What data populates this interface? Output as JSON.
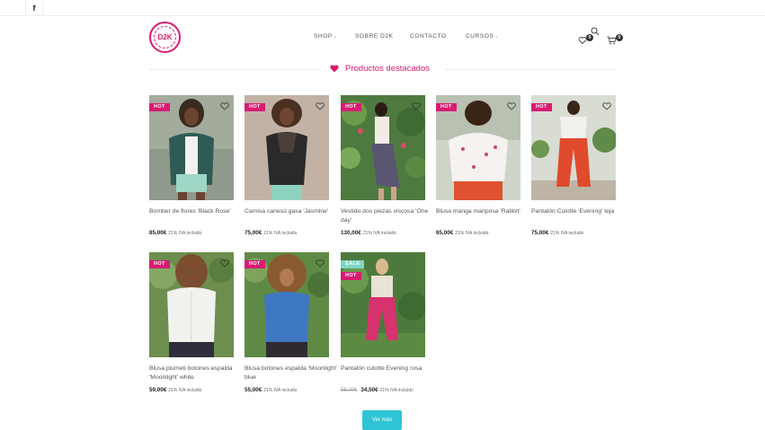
{
  "topbar": {
    "social_icon": "facebook-icon",
    "social_label": "f"
  },
  "logo": {
    "text": "D2K"
  },
  "nav": {
    "items": [
      {
        "label": "SHOP",
        "has_dropdown": true
      },
      {
        "label": "SOBRE D2K",
        "has_dropdown": false
      },
      {
        "label": "CONTACTO",
        "has_dropdown": false
      },
      {
        "label": "CURSOS",
        "has_dropdown": true
      }
    ],
    "dropdown_caret": "⌄"
  },
  "header_icons": {
    "wishlist_count": "0",
    "cart_count": "0"
  },
  "section": {
    "title": "Productos destacados"
  },
  "colors": {
    "accent": "#d81b72",
    "button": "#2ec4d6",
    "sale": "#7fd6c2"
  },
  "products": [
    {
      "name": "Bomber de flores 'Black Rose'",
      "price": "85,00€",
      "vat": "21% IVA incluido",
      "tags": [
        "HOT"
      ]
    },
    {
      "name": "Camisa canesú gasa 'Jasmine'",
      "price": "75,00€",
      "vat": "21% IVA incluido",
      "tags": [
        "HOT"
      ]
    },
    {
      "name": "Vestido dos piezas viscosa 'One day'",
      "price": "130,00€",
      "vat": "21% IVA incluido",
      "tags": [
        "HOT"
      ]
    },
    {
      "name": "Blusa manga mariposa 'Rabbit'",
      "price": "65,00€",
      "vat": "21% IVA incluido",
      "tags": [
        "HOT"
      ]
    },
    {
      "name": "Pantalón Culotte 'Evening' teja",
      "price": "75,00€",
      "vat": "21% IVA incluido",
      "tags": [
        "HOT"
      ]
    },
    {
      "name": "Blusa plumeti botones espalda 'Moonlight' white",
      "price": "59,00€",
      "vat": "21% IVA incluido",
      "tags": [
        "HOT"
      ]
    },
    {
      "name": "Blusa botones espalda 'Moonlight' blue",
      "price": "55,00€",
      "vat": "21% IVA incluido",
      "tags": [
        "HOT"
      ]
    },
    {
      "name": "Pantalón culotte Evening rosa",
      "old_price": "55,00€",
      "price": "34,50€",
      "vat": "21% IVA incluido",
      "tags": [
        "SALE",
        "HOT"
      ]
    }
  ],
  "load_more": {
    "label": "Ver más"
  }
}
